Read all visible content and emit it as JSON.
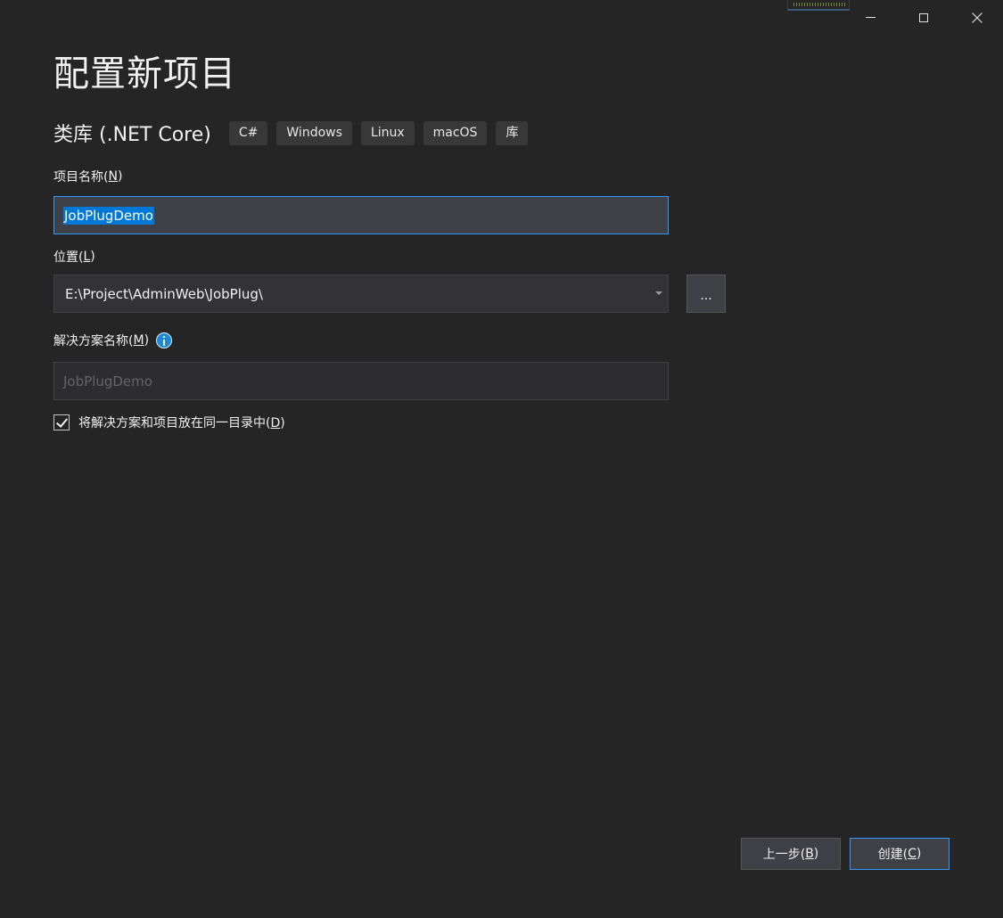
{
  "window": {
    "controls": {
      "minimize_icon": "minimize-icon",
      "maximize_icon": "maximize-icon",
      "close_icon": "close-icon"
    }
  },
  "page": {
    "title": "配置新项目"
  },
  "template": {
    "name": "类库 (.NET Core)",
    "tags": [
      "C#",
      "Windows",
      "Linux",
      "macOS",
      "库"
    ]
  },
  "project_name": {
    "label": "项目名称(",
    "label_mnemonic": "N",
    "label_suffix": ")",
    "value": "JobPlugDemo"
  },
  "location": {
    "label": "位置(",
    "label_mnemonic": "L",
    "label_suffix": ")",
    "value": "E:\\Project\\AdminWeb\\JobPlug\\",
    "browse_label": "..."
  },
  "solution_name": {
    "label": "解决方案名称(",
    "label_mnemonic": "M",
    "label_suffix": ")",
    "placeholder": "JobPlugDemo"
  },
  "same_dir_option": {
    "checked": true,
    "label": "将解决方案和项目放在同一目录中(",
    "label_mnemonic": "D",
    "label_suffix": ")"
  },
  "footer": {
    "back_label": "上一步(",
    "back_mnemonic": "B",
    "back_suffix": ")",
    "create_label": "创建(",
    "create_mnemonic": "C",
    "create_suffix": ")"
  },
  "colors": {
    "background": "#252526",
    "accent": "#3399ff",
    "selection": "#0078d7",
    "info_icon": "#1e8ad6"
  }
}
